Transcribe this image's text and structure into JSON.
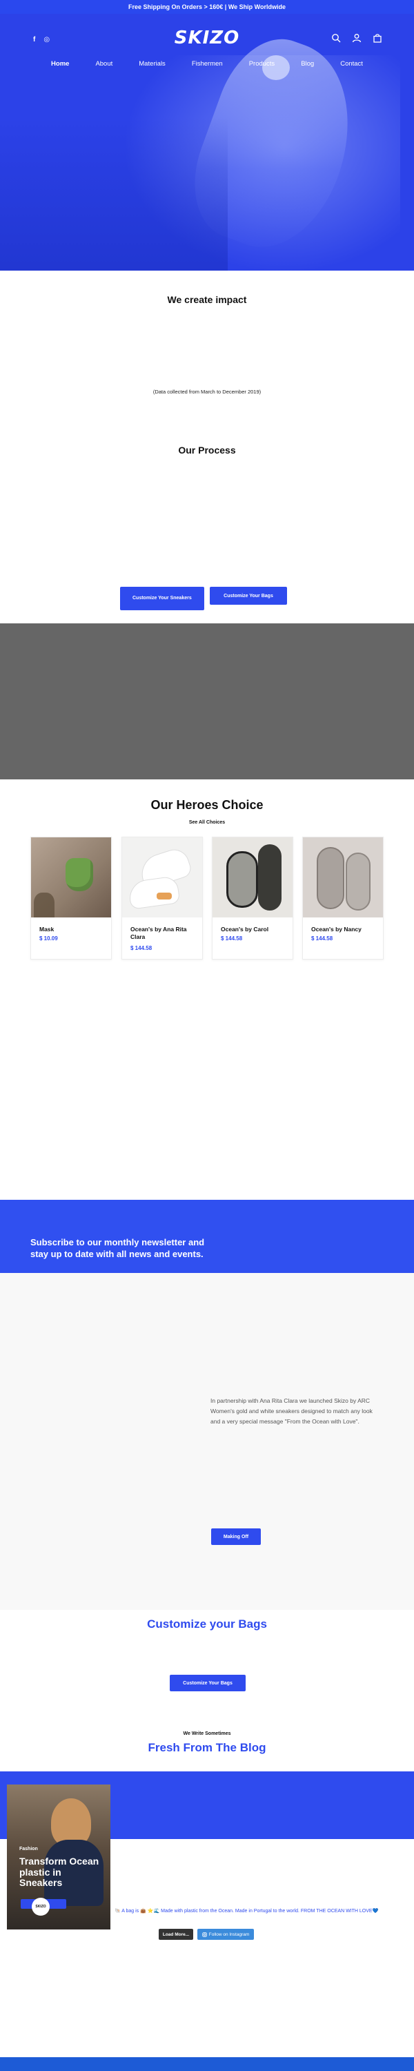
{
  "topbar": {
    "text": "Free Shipping On Orders > 160€ | We Ship Worldwide"
  },
  "header": {
    "logo": "SKIZO",
    "social": [
      "f",
      "◎"
    ],
    "icons": [
      "search-icon",
      "user-icon",
      "bag-icon"
    ],
    "nav": [
      {
        "label": "Home",
        "active": true
      },
      {
        "label": "About",
        "active": false
      },
      {
        "label": "Materials",
        "active": false
      },
      {
        "label": "Fishermen",
        "active": false
      },
      {
        "label": "Products",
        "active": false
      },
      {
        "label": "Blog",
        "active": false
      },
      {
        "label": "Contact",
        "active": false
      }
    ]
  },
  "impact": {
    "title": "We create impact",
    "note": "(Data collected from March to December 2019)"
  },
  "process": {
    "title": "Our Process",
    "buttons": {
      "sneakers": "Customize Your Sneakers",
      "bags": "Customize Your Bags"
    }
  },
  "heroes": {
    "title": "Our Heroes Choice",
    "see_all": "See All Choices",
    "products": [
      {
        "name": "Mask",
        "price": "$ 10.09"
      },
      {
        "name": "Ocean's by Ana Rita Clara",
        "price": "$ 144.58"
      },
      {
        "name": "Ocean's by Carol",
        "price": "$ 144.58"
      },
      {
        "name": "Ocean's by Nancy",
        "price": "$ 144.58"
      }
    ]
  },
  "newsletter": {
    "text": "Subscribe to our monthly newsletter and stay up to date with all news and events."
  },
  "partnership": {
    "text": "In partnership with Ana Rita Clara we launched Skizo by ARC Women's gold and white sneakers designed to match any look and a very special message \"From the Ocean with Love\".",
    "button": "Making Off"
  },
  "bags": {
    "title": "Customize your Bags",
    "button": "Customize Your Bags"
  },
  "blog": {
    "eyebrow": "We Write Sometimes",
    "title": "Fresh From The Blog",
    "post": {
      "category": "Fashion",
      "title": "Transform Ocean plastic in Sneakers",
      "badge": "SKIZO"
    }
  },
  "instagram": {
    "caption": "🐚 A bag is 👜 ⭐🌊 Made with plastic from the Ocean. Made in Portugal to the world. FROM THE OCEAN WITH LOVE💙",
    "load_more": "Load More...",
    "follow": "Follow on Instagram"
  },
  "colors": {
    "brand": "#2f4bee",
    "hero": "#2c42e8",
    "video": "#666666",
    "footer": "#1d5bd6"
  }
}
